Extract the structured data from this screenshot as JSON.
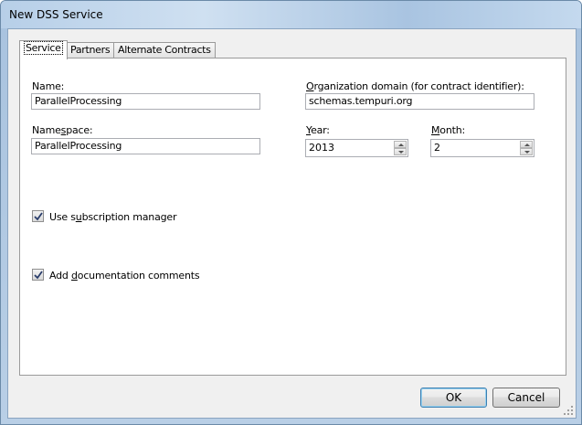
{
  "window": {
    "title": "New DSS Service"
  },
  "tabs": [
    {
      "label": "Service",
      "active": true
    },
    {
      "label": "Partners",
      "active": false
    },
    {
      "label": "Alternate Contracts",
      "active": false
    }
  ],
  "service": {
    "name_label": "Name:",
    "name_value": "ParallelProcessing",
    "namespace_label_a": "Name",
    "namespace_label_u": "s",
    "namespace_label_b": "pace:",
    "namespace_value": "ParallelProcessing",
    "org_label_u": "O",
    "org_label_rest": "rganization domain (for contract identifier):",
    "org_value": "schemas.tempuri.org",
    "year_label_u": "Y",
    "year_label_rest": "ear:",
    "year_value": "2013",
    "month_label_u": "M",
    "month_label_rest": "onth:",
    "month_value": "2",
    "subscription_label_a": "Use s",
    "subscription_label_u": "u",
    "subscription_label_b": "bscription manager",
    "subscription_checked": true,
    "doc_label_a": "Add ",
    "doc_label_u": "d",
    "doc_label_b": "ocumentation comments",
    "doc_checked": true
  },
  "buttons": {
    "ok": "OK",
    "cancel": "Cancel"
  },
  "icons": {
    "checkmark": "checkmark-icon",
    "spin_up": "spin-up-icon",
    "spin_down": "spin-down-icon",
    "grip": "resize-grip-icon"
  }
}
